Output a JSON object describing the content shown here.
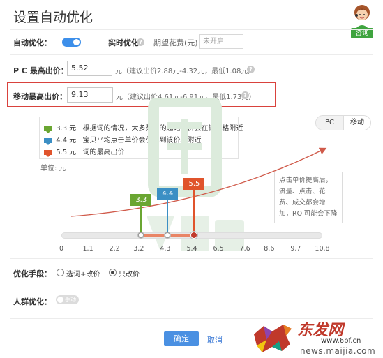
{
  "title": "设置自动优化",
  "consult": {
    "label": "咨询"
  },
  "auto": {
    "label": "自动优化：",
    "realtime_label": "实时优化",
    "period_label": "期望花费(元)：",
    "period_placeholder": "未开启"
  },
  "pc": {
    "label": "P C 最高出价：",
    "value": "5.52",
    "hint": "元（建议出价2.88元-4.32元，最低1.08元）"
  },
  "mobile": {
    "label": "移动最高出价：",
    "value": "9.13",
    "hint": "元（建议出价4.61元-6.91元，最低1.73元）"
  },
  "legend": [
    {
      "value": "3.3 元",
      "text": "根据词的情况，大多数词的起始出价会在该价格附近",
      "color": "#6aa632"
    },
    {
      "value": "4.4 元",
      "text": "宝贝平均点击单价会优化到该价格附近",
      "color": "#3b8fc4"
    },
    {
      "value": "5.5 元",
      "text": "词的最高出价",
      "color": "#e0542c"
    }
  ],
  "unit_label": "单位: 元",
  "segment": {
    "pc": "PC",
    "mobile": "移动"
  },
  "tip": "点击单价提高后，流量、点击、花费、成交都会增加，ROI可能会下降",
  "markers": [
    {
      "label": "3.3",
      "value": 3.3,
      "color": "#6aa632"
    },
    {
      "label": "4.4",
      "value": 4.4,
      "color": "#3b8fc4"
    },
    {
      "label": "5.5",
      "value": 5.5,
      "color": "#e0542c"
    }
  ],
  "axis": {
    "min": 0,
    "max": 10.8,
    "ticks": [
      "0",
      "1.1",
      "2.2",
      "3.2",
      "4.3",
      "5.4",
      "6.5",
      "7.6",
      "8.6",
      "9.7",
      "10.8"
    ]
  },
  "method": {
    "label": "优化手段：",
    "opt1": "选词+改价",
    "opt2": "只改价"
  },
  "crowd": {
    "label": "人群优化：",
    "toggle_text": "手动"
  },
  "buttons": {
    "ok": "确定",
    "cancel": "取消"
  },
  "watermark": {
    "brand": "东发网",
    "url": "www.6pf.cn",
    "site": "news.maijia.com"
  },
  "colors": {
    "accent": "#4a90e2",
    "highlight": "#d9423d",
    "curve": "#d05a4a"
  }
}
